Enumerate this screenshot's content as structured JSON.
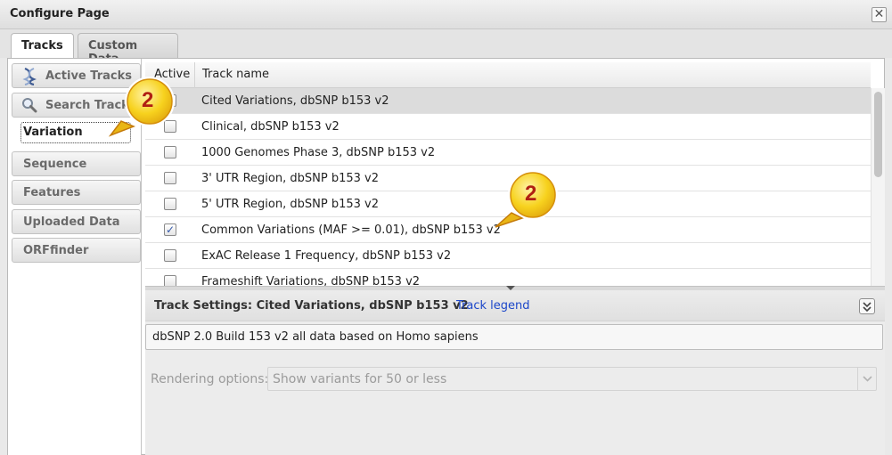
{
  "window": {
    "title": "Configure Page",
    "close_glyph": "✕"
  },
  "tabs": [
    {
      "label": "Tracks",
      "active": true
    },
    {
      "label": "Custom Data",
      "active": false
    }
  ],
  "sidebar": {
    "items": [
      {
        "label": "Active Tracks",
        "icon": "dna-helix-icon"
      },
      {
        "label": "Search Tracks",
        "icon": "magnifier-icon"
      },
      {
        "label": "Variation",
        "selected": true
      },
      {
        "label": "Sequence"
      },
      {
        "label": "Features"
      },
      {
        "label": "Uploaded Data"
      },
      {
        "label": "ORFfinder"
      }
    ]
  },
  "grid": {
    "col_active": "Active",
    "col_name": "Track name",
    "rows": [
      {
        "name": "Cited Variations, dbSNP b153 v2",
        "checked": false,
        "selected": true
      },
      {
        "name": "Clinical, dbSNP b153 v2",
        "checked": false
      },
      {
        "name": "1000 Genomes Phase 3, dbSNP b153 v2",
        "checked": false
      },
      {
        "name": "3' UTR Region, dbSNP b153 v2",
        "checked": false
      },
      {
        "name": "5' UTR Region, dbSNP b153 v2",
        "checked": false
      },
      {
        "name": "Common Variations (MAF >= 0.01), dbSNP b153 v2",
        "checked": true
      },
      {
        "name": "ExAC Release 1 Frequency, dbSNP b153 v2",
        "checked": false
      },
      {
        "name": "Frameshift Variations, dbSNP b153 v2",
        "checked": false
      }
    ]
  },
  "settings": {
    "title": "Track Settings: Cited Variations, dbSNP b153 v2",
    "legend_link": "Track legend",
    "description": "dbSNP 2.0 Build 153 v2 all data based on Homo sapiens",
    "rendering_label": "Rendering options:",
    "rendering_value": "Show variants for 50 or less"
  },
  "callouts": [
    {
      "number": "2",
      "target": "Variation"
    },
    {
      "number": "2",
      "target": "Common Variations (MAF >= 0.01), dbSNP b153 v2"
    }
  ],
  "colors": {
    "link": "#1b46c9",
    "callout_fill": "#f7d21e",
    "callout_text": "#b01f12",
    "selected_row": "#dcdcdc"
  }
}
